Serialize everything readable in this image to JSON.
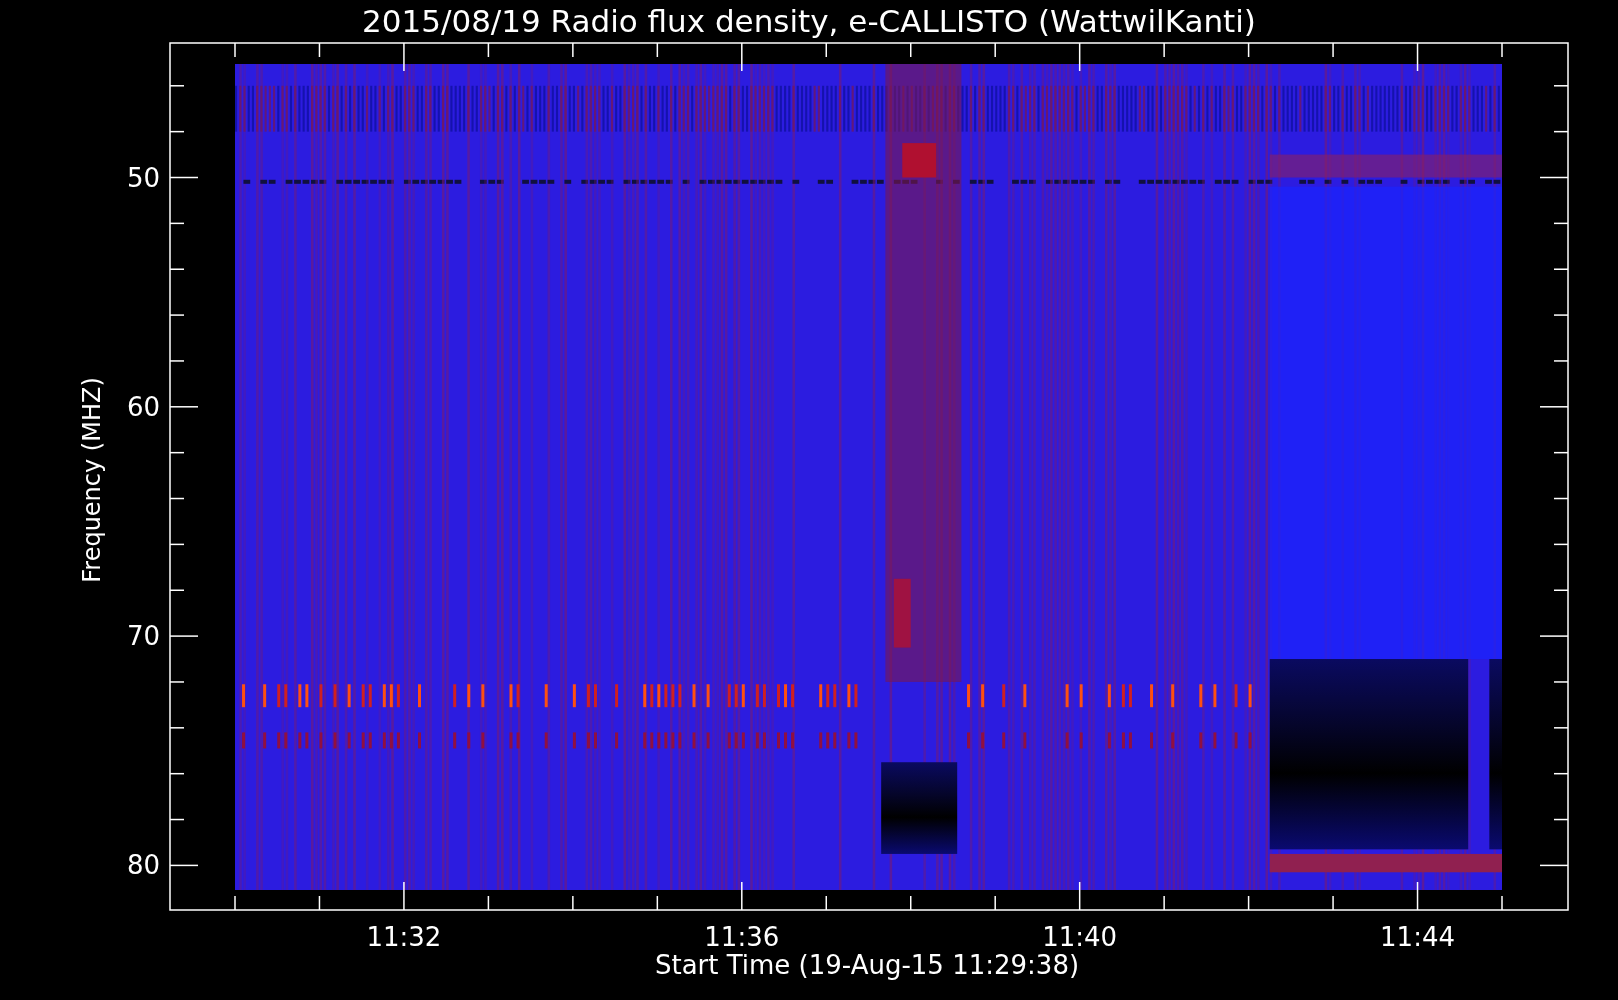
{
  "title": "2015/08/19  Radio flux density, e-CALLISTO (WattwilKanti)",
  "x_axis": {
    "label": "Start Time (19-Aug-15 11:29:38)",
    "ticks": [
      "11:32",
      "11:36",
      "11:40",
      "11:44"
    ]
  },
  "y_axis": {
    "label": "Frequency (MHZ)",
    "ticks": [
      "50",
      "60",
      "70",
      "80"
    ]
  }
}
